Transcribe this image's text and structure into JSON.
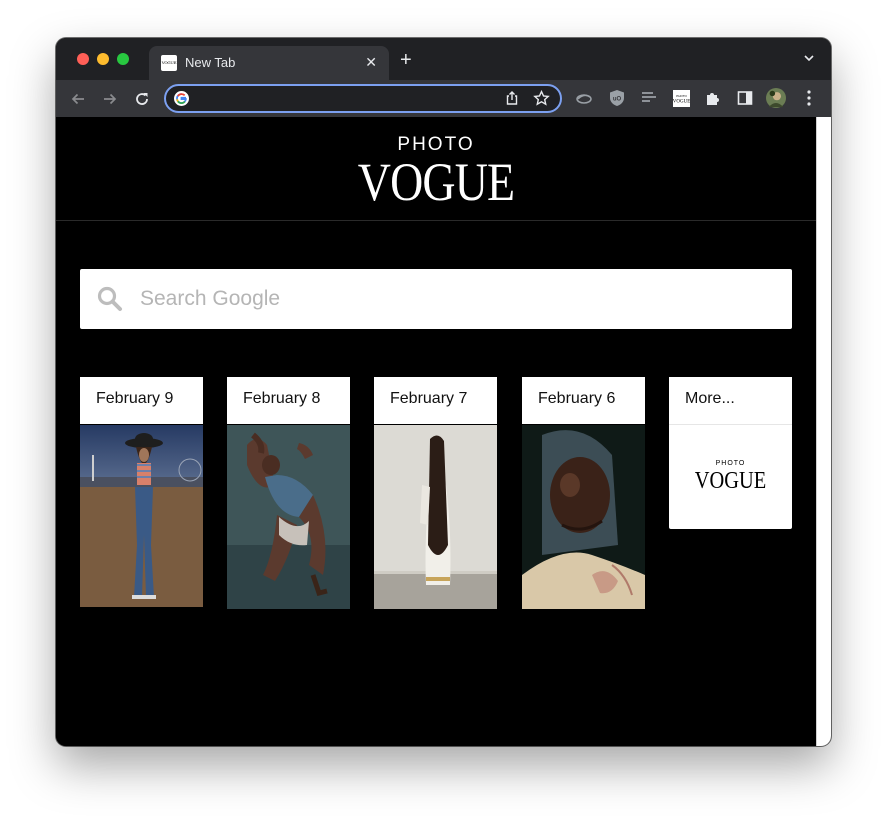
{
  "browser": {
    "tab_title": "New Tab",
    "tab_favicon_text": "VOGUE",
    "tab_close_glyph": "✕",
    "new_tab_glyph": "+",
    "address_value": "",
    "icons": [
      "back-icon",
      "forward-icon",
      "reload-icon",
      "google-icon",
      "share-icon",
      "star-icon",
      "extension-cloud-icon",
      "ublock-icon",
      "reading-list-icon",
      "photo-vogue-extension-icon",
      "puzzle-icon",
      "side-panel-icon",
      "profile-avatar",
      "kebab-menu-icon",
      "tab-menu-chevron-icon"
    ],
    "accent": "#7ca0f0"
  },
  "header": {
    "photo_label": "PHOTO",
    "vogue_label": "VOGUE"
  },
  "search": {
    "placeholder": "Search Google"
  },
  "cards": [
    {
      "label": "February 9"
    },
    {
      "label": "February 8"
    },
    {
      "label": "February 7"
    },
    {
      "label": "February 6"
    }
  ],
  "more": {
    "label": "More...",
    "photo_label": "PHOTO",
    "vogue_label": "VOGUE"
  },
  "colors": {
    "page_background": "#000000",
    "tabbar": "#202124",
    "toolbar": "#35363a"
  }
}
